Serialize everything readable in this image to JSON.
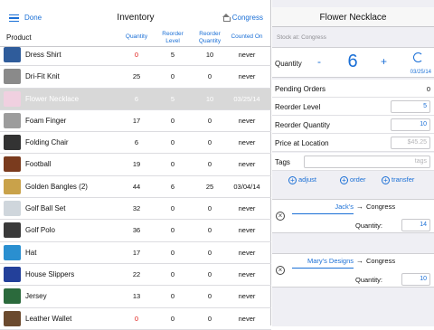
{
  "status_bar": {
    "battery_icon": "battery-icon"
  },
  "inventory": {
    "nav": {
      "done_label": "Done",
      "title": "Inventory",
      "location_label": "Congress"
    },
    "columns": {
      "product": "Product",
      "quantity": "Quantity",
      "reorder_level": "Reorder Level",
      "reorder_quantity": "Reorder Quantity",
      "counted_on": "Counted On"
    },
    "rows": [
      {
        "name": "Dress Shirt",
        "quantity": "0",
        "reorder_level": "5",
        "reorder_quantity": "10",
        "counted_on": "never",
        "quantity_red": true,
        "thumb_color": "#2f5c9b"
      },
      {
        "name": "Dri-Fit Knit",
        "quantity": "25",
        "reorder_level": "0",
        "reorder_quantity": "0",
        "counted_on": "never",
        "thumb_color": "#8a8a8a"
      },
      {
        "name": "Flower Necklace",
        "quantity": "6",
        "reorder_level": "5",
        "reorder_quantity": "10",
        "counted_on": "03/25/14",
        "selected": true,
        "thumb_color": "#f0d0e0"
      },
      {
        "name": "Foam Finger",
        "quantity": "17",
        "reorder_level": "0",
        "reorder_quantity": "0",
        "counted_on": "never",
        "thumb_color": "#9c9c9c"
      },
      {
        "name": "Folding Chair",
        "quantity": "6",
        "reorder_level": "0",
        "reorder_quantity": "0",
        "counted_on": "never",
        "thumb_color": "#333333"
      },
      {
        "name": "Football",
        "quantity": "19",
        "reorder_level": "0",
        "reorder_quantity": "0",
        "counted_on": "never",
        "thumb_color": "#7a3b1e"
      },
      {
        "name": "Golden Bangles (2)",
        "quantity": "44",
        "reorder_level": "6",
        "reorder_quantity": "25",
        "counted_on": "03/04/14",
        "thumb_color": "#c9a24a"
      },
      {
        "name": "Golf Ball Set",
        "quantity": "32",
        "reorder_level": "0",
        "reorder_quantity": "0",
        "counted_on": "never",
        "thumb_color": "#cfd6dc"
      },
      {
        "name": "Golf Polo",
        "quantity": "36",
        "reorder_level": "0",
        "reorder_quantity": "0",
        "counted_on": "never",
        "thumb_color": "#3a3a3a"
      },
      {
        "name": "Hat",
        "quantity": "17",
        "reorder_level": "0",
        "reorder_quantity": "0",
        "counted_on": "never",
        "thumb_color": "#2a8fd0"
      },
      {
        "name": "House Slippers",
        "quantity": "22",
        "reorder_level": "0",
        "reorder_quantity": "0",
        "counted_on": "never",
        "thumb_color": "#23409a"
      },
      {
        "name": "Jersey",
        "quantity": "13",
        "reorder_level": "0",
        "reorder_quantity": "0",
        "counted_on": "never",
        "thumb_color": "#2b6a3c"
      },
      {
        "name": "Leather Wallet",
        "quantity": "0",
        "reorder_level": "0",
        "reorder_quantity": "0",
        "counted_on": "never",
        "quantity_red": true,
        "thumb_color": "#6b4a2e"
      }
    ]
  },
  "detail": {
    "title": "Flower Necklace",
    "stock_at": "Stock at: Congress",
    "quantity_label": "Quantity",
    "minus": "-",
    "quantity_value": "6",
    "plus": "+",
    "quantity_date": "03/25/14",
    "pending_orders_label": "Pending Orders",
    "pending_orders_value": "0",
    "reorder_level_label": "Reorder Level",
    "reorder_level_value": "5",
    "reorder_quantity_label": "Reorder Quantity",
    "reorder_quantity_value": "10",
    "price_label": "Price at Location",
    "price_placeholder": "$45.25",
    "tags_label": "Tags",
    "tags_placeholder": "tags",
    "actions": {
      "adjust": "adjust",
      "order": "order",
      "transfer": "transfer"
    },
    "transfers": [
      {
        "from": "Jack's",
        "arrow": "→",
        "to": "Congress",
        "quantity_label": "Quantity:",
        "quantity": "14"
      },
      {
        "from": "Mary's Designs",
        "arrow": "→",
        "to": "Congress",
        "quantity_label": "Quantity:",
        "quantity": "10"
      }
    ]
  }
}
